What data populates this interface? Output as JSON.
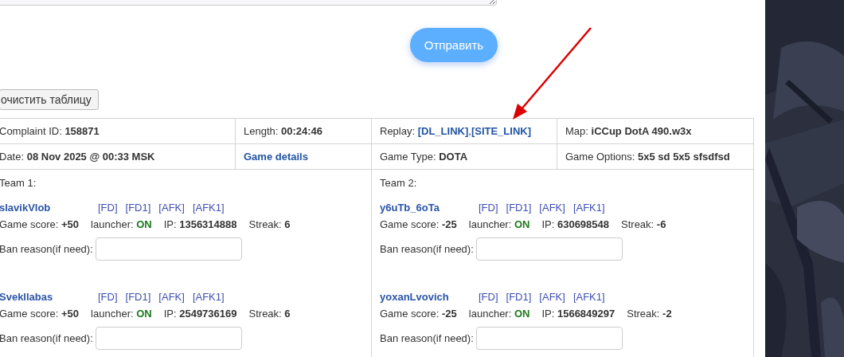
{
  "send_button": "Отправить",
  "clear_button": "очистить таблицу",
  "info_rows": [
    [
      {
        "kind": "field",
        "label": "Complaint ID:",
        "value": "158871"
      },
      {
        "kind": "field",
        "label": "Length:",
        "value": "00:24:46"
      },
      {
        "kind": "links",
        "label": "Replay:",
        "links": [
          "[DL_LINK]",
          "[SITE_LINK]"
        ],
        "separator": ","
      },
      {
        "kind": "field",
        "label": "Map:",
        "value": "iCCup DotA 490.w3x"
      }
    ],
    [
      {
        "kind": "field",
        "label": "Date:",
        "value": "08 Nov 2025 @ 00:33 MSK"
      },
      {
        "kind": "link",
        "text": "Game details"
      },
      {
        "kind": "field",
        "label": "Game Type:",
        "value": "DOTA"
      },
      {
        "kind": "field",
        "label": "Game Options:",
        "value": "5x5 sd 5x5 sfsdfsd"
      }
    ]
  ],
  "teams": [
    {
      "title": "Team 1:",
      "players": [
        {
          "name": "slavikVlob",
          "flags": [
            "[FD]",
            "[FD1]",
            "[AFK]",
            "[AFK1]"
          ],
          "stats": [
            {
              "kind": "plain",
              "label": "Game score:",
              "value": "+50"
            },
            {
              "kind": "status",
              "label": "launcher:",
              "value": "ON"
            },
            {
              "kind": "plain",
              "label": "IP:",
              "value": "1356314888"
            },
            {
              "kind": "plain",
              "label": "Streak:",
              "value": "6"
            }
          ],
          "ban_label": "Ban reason(if need):"
        },
        {
          "name": "Svekllabas",
          "flags": [
            "[FD]",
            "[FD1]",
            "[AFK]",
            "[AFK1]"
          ],
          "stats": [
            {
              "kind": "plain",
              "label": "Game score:",
              "value": "+50"
            },
            {
              "kind": "status",
              "label": "launcher:",
              "value": "ON"
            },
            {
              "kind": "plain",
              "label": "IP:",
              "value": "2549736169"
            },
            {
              "kind": "plain",
              "label": "Streak:",
              "value": "6"
            }
          ],
          "ban_label": "Ban reason(if need):"
        }
      ]
    },
    {
      "title": "Team 2:",
      "players": [
        {
          "name": "y6uTb_6oTa",
          "flags": [
            "[FD]",
            "[FD1]",
            "[AFK]",
            "[AFK1]"
          ],
          "stats": [
            {
              "kind": "plain",
              "label": "Game score:",
              "value": "-25"
            },
            {
              "kind": "status",
              "label": "launcher:",
              "value": "ON"
            },
            {
              "kind": "plain",
              "label": "IP:",
              "value": "630698548"
            },
            {
              "kind": "plain",
              "label": "Streak:",
              "value": "-6"
            }
          ],
          "ban_label": "Ban reason(if need):"
        },
        {
          "name": "yoxanLvovich",
          "flags": [
            "[FD]",
            "[FD1]",
            "[AFK]",
            "[AFK1]"
          ],
          "stats": [
            {
              "kind": "plain",
              "label": "Game score:",
              "value": "-25"
            },
            {
              "kind": "status",
              "label": "launcher:",
              "value": "ON"
            },
            {
              "kind": "plain",
              "label": "IP:",
              "value": "1566849297"
            },
            {
              "kind": "plain",
              "label": "Streak:",
              "value": "-2"
            }
          ],
          "ban_label": "Ban reason(if need):"
        }
      ]
    }
  ]
}
